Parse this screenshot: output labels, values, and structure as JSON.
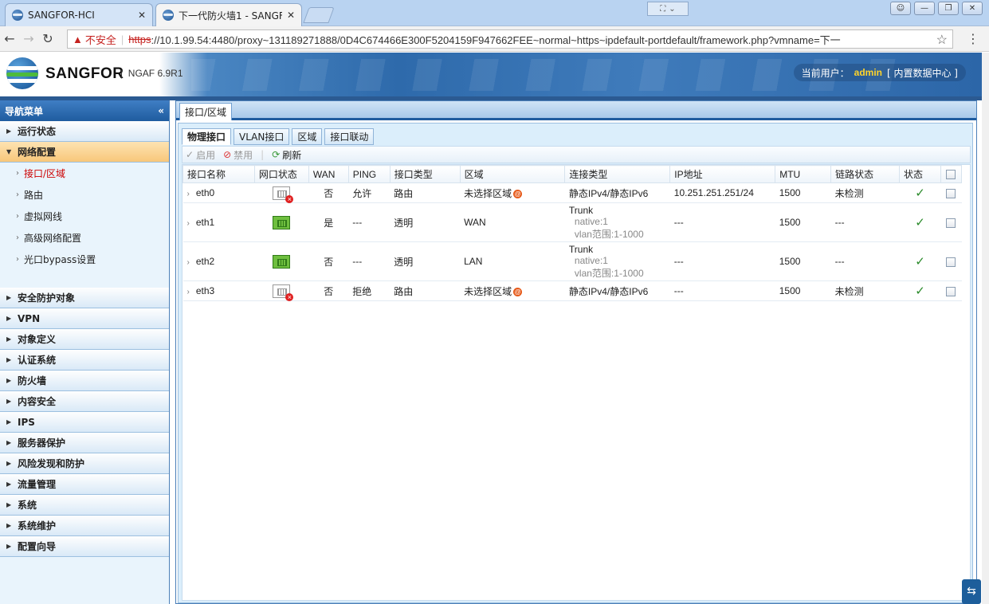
{
  "browser": {
    "tabs": [
      {
        "title": "SANGFOR-HCI"
      },
      {
        "title": "下一代防火墙1 - SANGF"
      }
    ],
    "address": {
      "insecure_label": "不安全",
      "scheme": "https",
      "url_rest": "://10.1.99.54:4480/proxy~131189271888/0D4C674466E300F5204159F947662FEE~normal~https~ipdefault-portdefault/framework.php?vmname=下一"
    }
  },
  "header": {
    "brand": "SANGFOR",
    "version": "NGAF 6.9R1",
    "user_label": "当前用户：",
    "user_name": "admin",
    "datacenter": "[ 内置数据中心 ]"
  },
  "sidebar": {
    "title": "导航菜单",
    "collapse_glyph": "«",
    "items": [
      {
        "label": "运行状态"
      },
      {
        "label": "网络配置"
      },
      {
        "label": "安全防护对象"
      },
      {
        "label": "VPN"
      },
      {
        "label": "对象定义"
      },
      {
        "label": "认证系统"
      },
      {
        "label": "防火墙"
      },
      {
        "label": "内容安全"
      },
      {
        "label": "IPS"
      },
      {
        "label": "服务器保护"
      },
      {
        "label": "风险发现和防护"
      },
      {
        "label": "流量管理"
      },
      {
        "label": "系统"
      },
      {
        "label": "系统维护"
      },
      {
        "label": "配置向导"
      }
    ],
    "sub_items": [
      {
        "label": "接口/区域"
      },
      {
        "label": "路由"
      },
      {
        "label": "虚拟网线"
      },
      {
        "label": "高级网络配置"
      },
      {
        "label": "光口bypass设置"
      }
    ]
  },
  "content": {
    "tab_title": "接口/区域",
    "subtabs": [
      "物理接口",
      "VLAN接口",
      "区域",
      "接口联动"
    ],
    "toolbar": {
      "enable": "启用",
      "disable": "禁用",
      "refresh": "刷新"
    },
    "columns": [
      "接口名称",
      "网口状态",
      "WAN",
      "PING",
      "接口类型",
      "区域",
      "连接类型",
      "IP地址",
      "MTU",
      "链路状态",
      "状态"
    ],
    "rows": [
      {
        "name": "eth0",
        "port": "down",
        "wan": "否",
        "ping": "允许",
        "type": "路由",
        "zone": "未选择区域",
        "conn": "静态IPv4/静态IPv6",
        "conn_sub1": "",
        "conn_sub2": "",
        "ip": "10.251.251.251/24",
        "mtu": "1500",
        "link": "未检测"
      },
      {
        "name": "eth1",
        "port": "up",
        "wan": "是",
        "ping": "---",
        "type": "透明",
        "zone": "WAN",
        "conn": "Trunk",
        "conn_sub1": "native:1",
        "conn_sub2": "vlan范围:1-1000",
        "ip": "---",
        "mtu": "1500",
        "link": "---"
      },
      {
        "name": "eth2",
        "port": "up",
        "wan": "否",
        "ping": "---",
        "type": "透明",
        "zone": "LAN",
        "conn": "Trunk",
        "conn_sub1": "native:1",
        "conn_sub2": "vlan范围:1-1000",
        "ip": "---",
        "mtu": "1500",
        "link": "---"
      },
      {
        "name": "eth3",
        "port": "down",
        "wan": "否",
        "ping": "拒绝",
        "type": "路由",
        "zone": "未选择区域",
        "conn": "静态IPv4/静态IPv6",
        "conn_sub1": "",
        "conn_sub2": "",
        "ip": "---",
        "mtu": "1500",
        "link": "未检测"
      }
    ]
  }
}
